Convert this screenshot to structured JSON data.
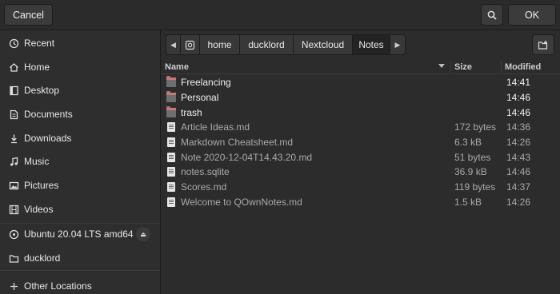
{
  "header": {
    "cancel_label": "Cancel",
    "ok_label": "OK"
  },
  "sidebar": {
    "items": [
      {
        "label": "Recent",
        "icon": "clock-icon"
      },
      {
        "label": "Home",
        "icon": "home-icon"
      },
      {
        "label": "Desktop",
        "icon": "desktop-icon"
      },
      {
        "label": "Documents",
        "icon": "document-icon"
      },
      {
        "label": "Downloads",
        "icon": "download-icon"
      },
      {
        "label": "Music",
        "icon": "music-icon"
      },
      {
        "label": "Pictures",
        "icon": "picture-icon"
      },
      {
        "label": "Videos",
        "icon": "video-icon"
      },
      {
        "label": "Ubuntu 20.04 LTS amd64",
        "icon": "disc-icon"
      },
      {
        "label": "ducklord",
        "icon": "folder-icon"
      },
      {
        "label": "Other Locations",
        "icon": "plus-icon"
      }
    ]
  },
  "pathbar": {
    "segments": [
      "home",
      "ducklord",
      "Nextcloud",
      "Notes"
    ]
  },
  "filelist": {
    "columns": {
      "name": "Name",
      "size": "Size",
      "modified": "Modified"
    },
    "rows": [
      {
        "name": "Freelancing",
        "size": "",
        "modified": "14:41",
        "type": "folder"
      },
      {
        "name": "Personal",
        "size": "",
        "modified": "14:46",
        "type": "folder"
      },
      {
        "name": "trash",
        "size": "",
        "modified": "14:46",
        "type": "folder"
      },
      {
        "name": "Article Ideas.md",
        "size": "172 bytes",
        "modified": "14:36",
        "type": "file"
      },
      {
        "name": "Markdown Cheatsheet.md",
        "size": "6.3 kB",
        "modified": "14:26",
        "type": "file"
      },
      {
        "name": "Note 2020-12-04T14.43.20.md",
        "size": "51 bytes",
        "modified": "14:43",
        "type": "file"
      },
      {
        "name": "notes.sqlite",
        "size": "36.9 kB",
        "modified": "14:46",
        "type": "file"
      },
      {
        "name": "Scores.md",
        "size": "119 bytes",
        "modified": "14:37",
        "type": "file"
      },
      {
        "name": "Welcome to QOwnNotes.md",
        "size": "1.5 kB",
        "modified": "14:26",
        "type": "file"
      }
    ]
  },
  "colors": {
    "background": "#2c2c2c",
    "folder_accent": "#c47a7a"
  }
}
